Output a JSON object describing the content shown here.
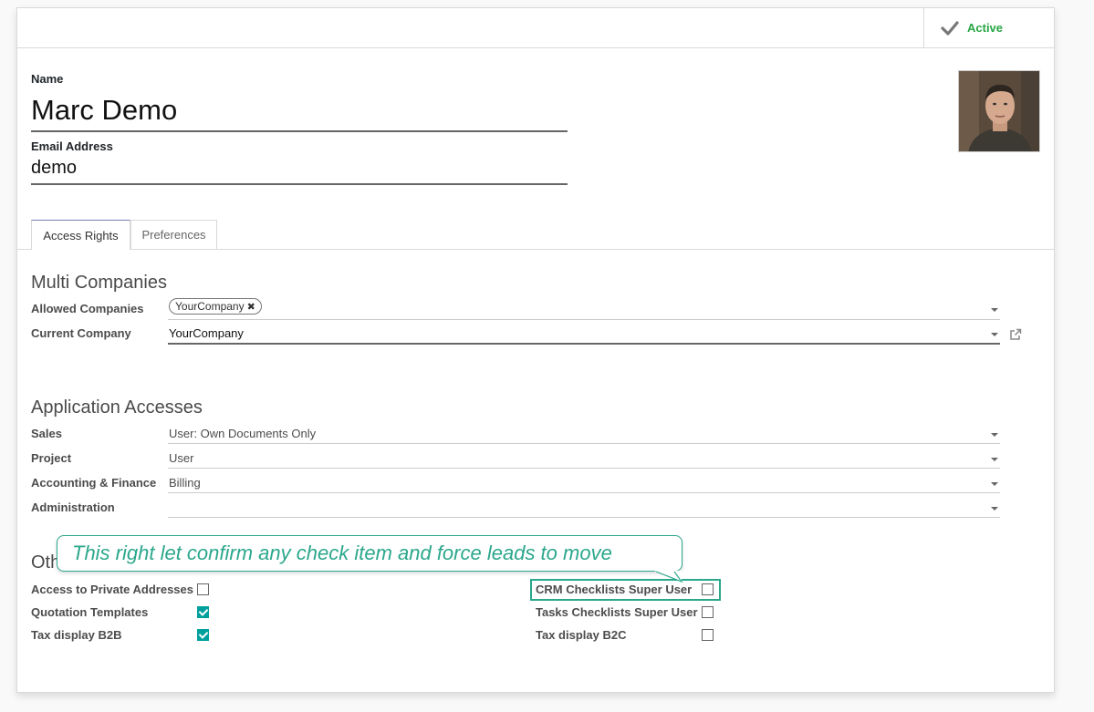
{
  "header": {
    "active_label": "Active"
  },
  "user": {
    "name_label": "Name",
    "name": "Marc Demo",
    "email_label": "Email Address",
    "email": "demo"
  },
  "tabs": [
    {
      "label": "Access Rights"
    },
    {
      "label": "Preferences"
    }
  ],
  "multi_companies": {
    "title": "Multi Companies",
    "allowed_label": "Allowed Companies",
    "allowed_tag": "YourCompany",
    "current_label": "Current Company",
    "current_value": "YourCompany"
  },
  "app_accesses": {
    "title": "Application Accesses",
    "rows": [
      {
        "label": "Sales",
        "value": "User: Own Documents Only"
      },
      {
        "label": "Project",
        "value": "User"
      },
      {
        "label": "Accounting & Finance",
        "value": "Billing"
      },
      {
        "label": "Administration",
        "value": ""
      }
    ]
  },
  "other": {
    "title_partial": "Oth",
    "left": [
      {
        "label": "Access to Private Addresses",
        "checked": false
      },
      {
        "label": "Quotation Templates",
        "checked": true
      },
      {
        "label": "Tax display B2B",
        "checked": true
      }
    ],
    "right": [
      {
        "label": "CRM Checklists Super User",
        "checked": false
      },
      {
        "label": "Tasks Checklists Super User",
        "checked": false
      },
      {
        "label": "Tax display B2C",
        "checked": false
      }
    ]
  },
  "callout": {
    "text": "This right let confirm any check item and force leads to move"
  },
  "colors": {
    "accent": "#00a09d",
    "active": "#28a745",
    "callout": "#2ba78c"
  }
}
